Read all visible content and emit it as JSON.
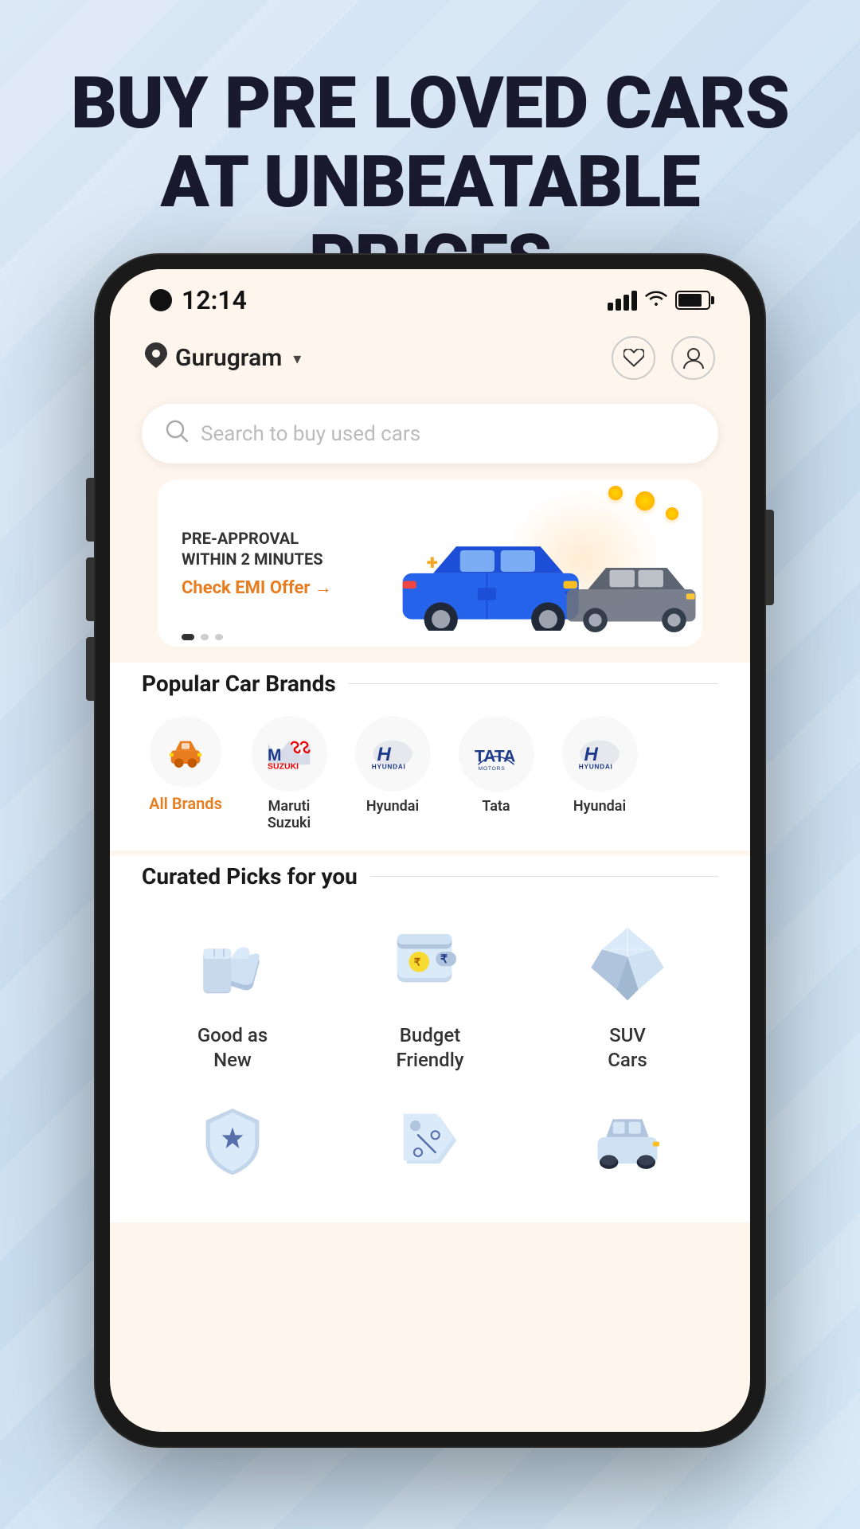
{
  "hero": {
    "line1": "BUY PRE LOVED CARS",
    "line2": "AT UNBEATABLE PRICES"
  },
  "status_bar": {
    "time": "12:14"
  },
  "header": {
    "location": "Gurugram",
    "wishlist_label": "wishlist",
    "profile_label": "profile"
  },
  "search": {
    "placeholder": "Search to buy used cars"
  },
  "banner": {
    "line1": "PRE-APPROVAL",
    "line2": "WITHIN 2 MINUTES",
    "cta": "Check EMI Offer →"
  },
  "popular_brands": {
    "title": "Popular Car Brands",
    "items": [
      {
        "label": "All Brands",
        "active": true
      },
      {
        "label": "Maruti\nSuzuki",
        "active": false
      },
      {
        "label": "Hyundai",
        "active": false
      },
      {
        "label": "Tata",
        "active": false
      },
      {
        "label": "Hyundai",
        "active": false
      }
    ]
  },
  "curated_picks": {
    "title": "Curated Picks for you",
    "items": [
      {
        "label": "Good as\nNew",
        "icon": "thumb-up"
      },
      {
        "label": "Budget\nFriendly",
        "icon": "wallet"
      },
      {
        "label": "SUV\nCars",
        "icon": "diamond"
      }
    ],
    "items2": [
      {
        "label": "",
        "icon": "shield-star"
      },
      {
        "label": "",
        "icon": "tag-percent"
      },
      {
        "label": "",
        "icon": "car-small"
      }
    ]
  }
}
